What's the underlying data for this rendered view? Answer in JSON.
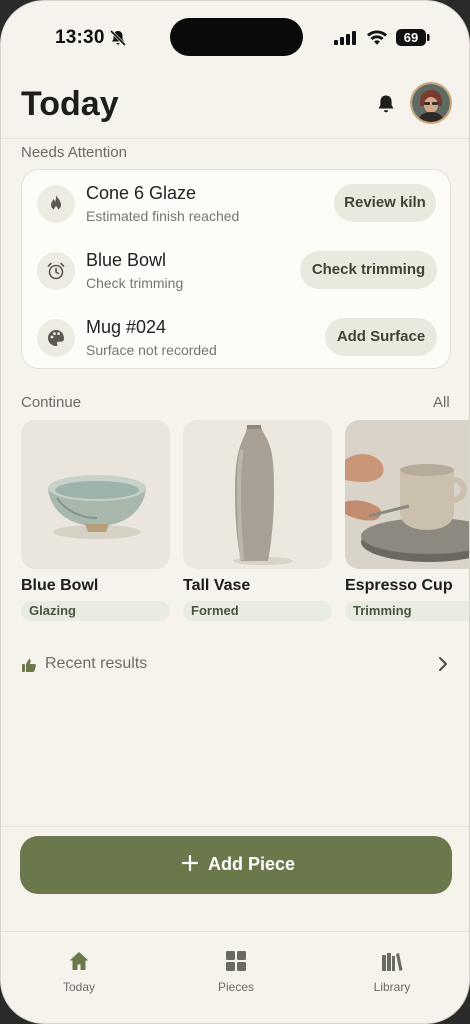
{
  "status": {
    "time": "13:30",
    "battery": "69"
  },
  "header": {
    "title": "Today"
  },
  "needs_attention": {
    "label": "Needs Attention",
    "items": [
      {
        "icon": "flame-icon",
        "title": "Cone 6 Glaze",
        "subtitle": "Estimated finish reached",
        "action": "Review kiln"
      },
      {
        "icon": "alarm-clock-icon",
        "title": "Blue Bowl",
        "subtitle": "Check trimming",
        "action": "Check trimming"
      },
      {
        "icon": "palette-icon",
        "title": "Mug #024",
        "subtitle": "Surface not recorded",
        "action": "Add Surface"
      }
    ]
  },
  "continue": {
    "label": "Continue",
    "all_label": "All",
    "pieces": [
      {
        "name": "Blue Bowl",
        "status": "Glazing"
      },
      {
        "name": "Tall Vase",
        "status": "Formed"
      },
      {
        "name": "Espresso Cup",
        "status": "Trimming"
      }
    ]
  },
  "recent": {
    "label": "Recent results"
  },
  "add_piece": {
    "label": "Add Piece"
  },
  "tabs": [
    {
      "label": "Today",
      "icon": "home-icon"
    },
    {
      "label": "Pieces",
      "icon": "grid-icon"
    },
    {
      "label": "Library",
      "icon": "books-icon"
    }
  ],
  "colors": {
    "accent": "#6a784b",
    "background": "#f6f3ec",
    "pill": "#e7ebdf"
  }
}
